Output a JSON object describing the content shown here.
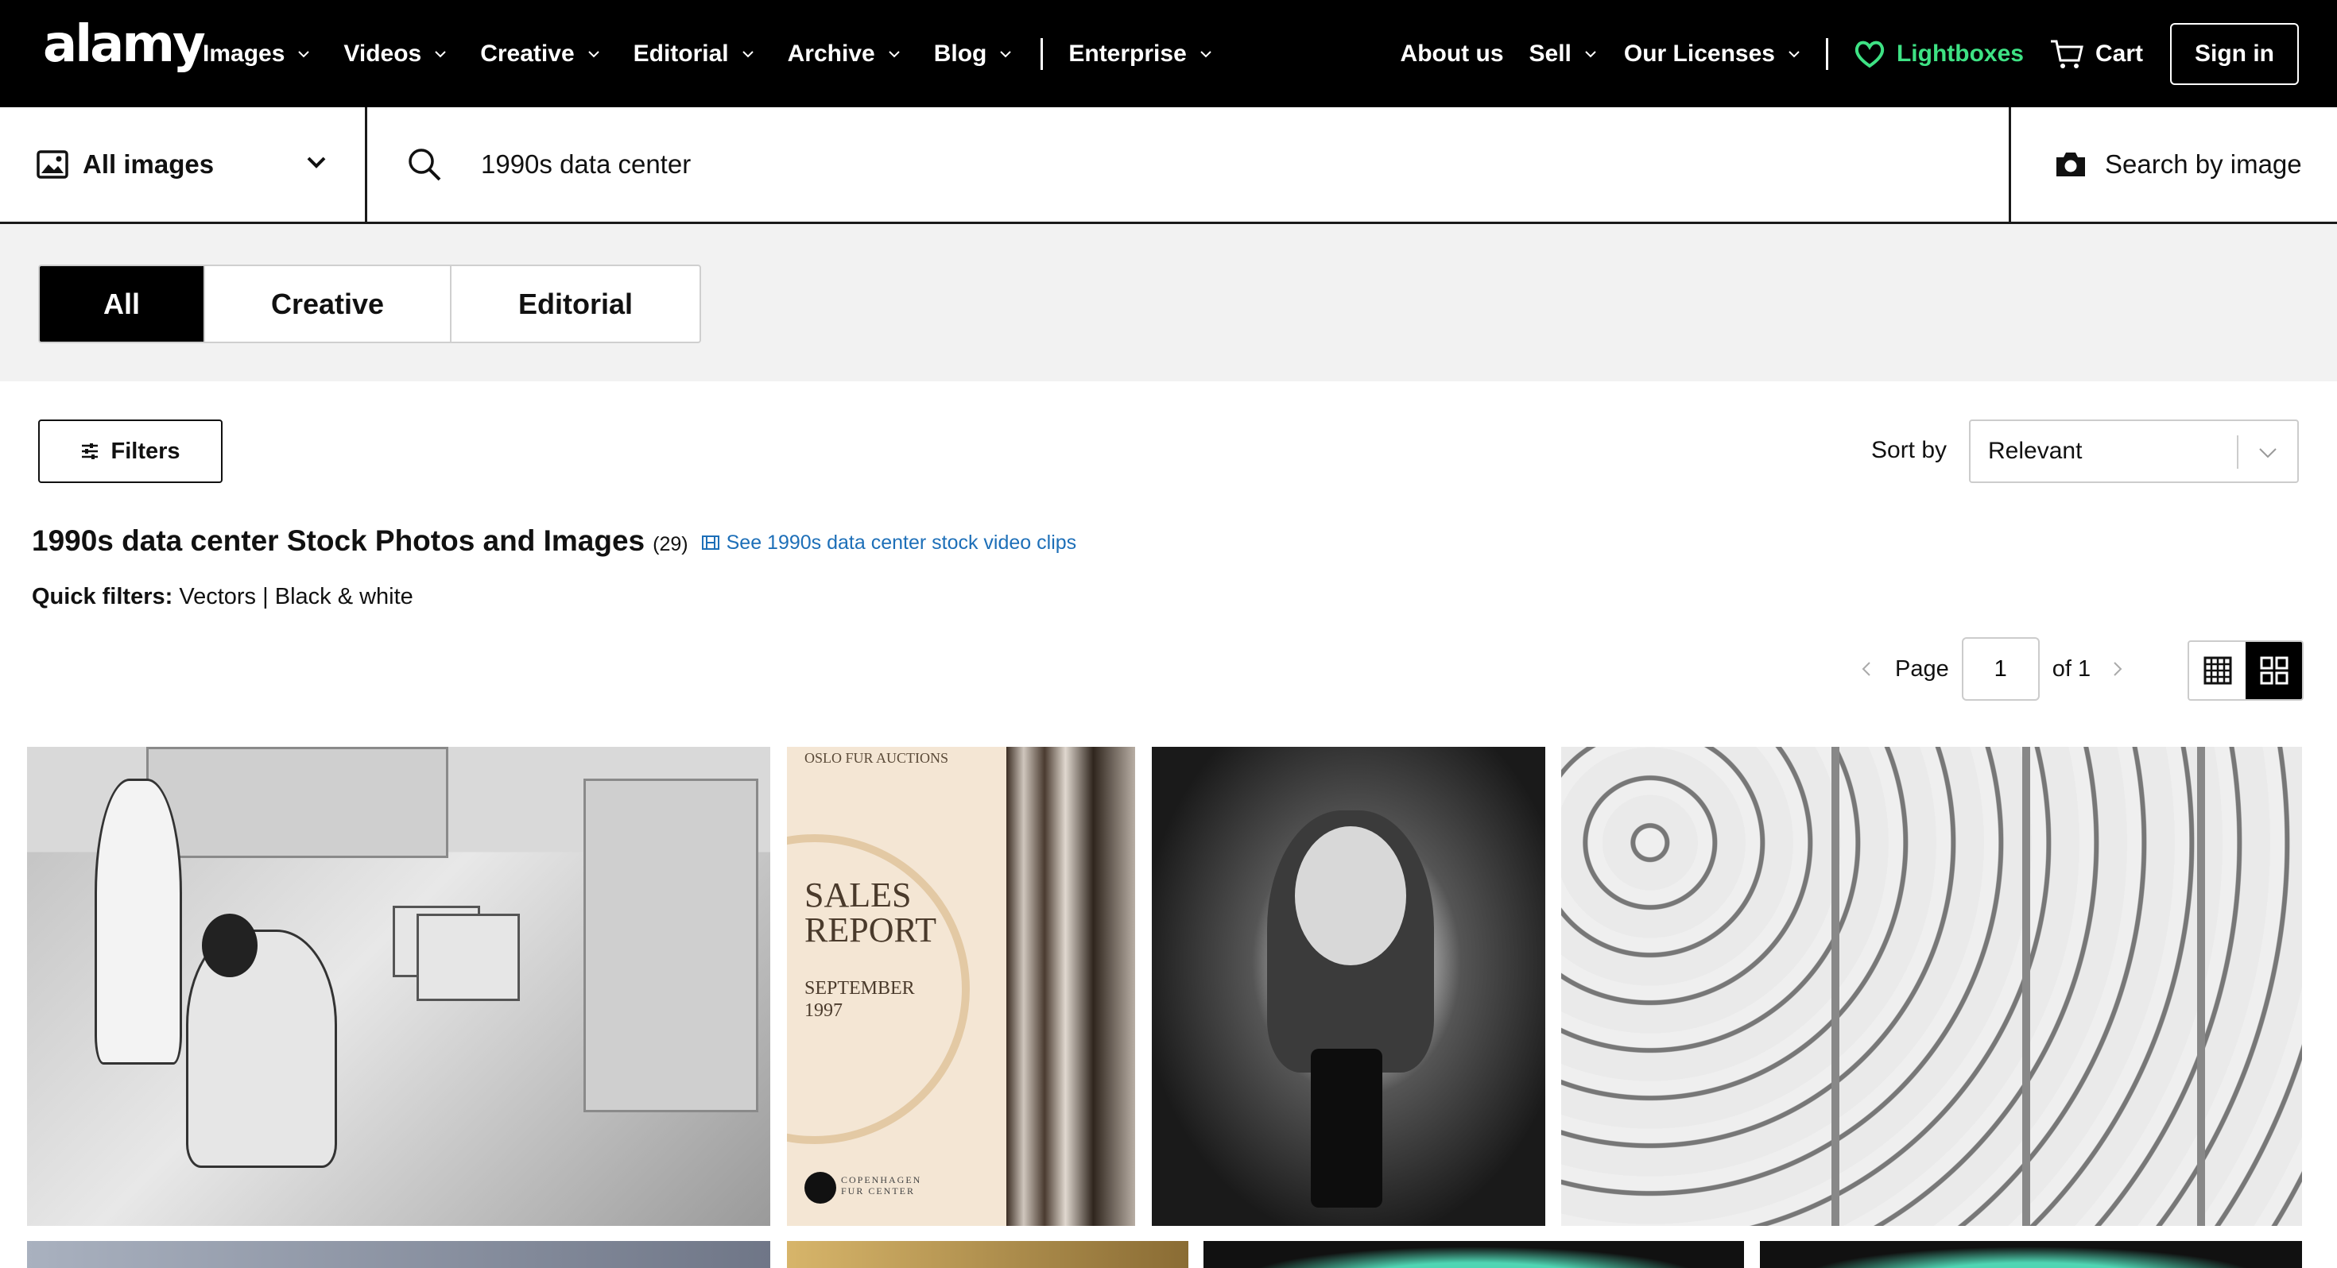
{
  "brand": {
    "logo_text": "alamy",
    "accent": "#3ee284",
    "link_color": "#1d6fb8"
  },
  "nav": {
    "left": [
      {
        "label": "Images",
        "dropdown": true
      },
      {
        "label": "Videos",
        "dropdown": true
      },
      {
        "label": "Creative",
        "dropdown": true
      },
      {
        "label": "Editorial",
        "dropdown": true
      },
      {
        "label": "Archive",
        "dropdown": true
      },
      {
        "label": "Blog",
        "dropdown": true
      },
      {
        "label": "Enterprise",
        "dropdown": true
      }
    ],
    "right": {
      "about": "About us",
      "sell": "Sell",
      "licenses": "Our Licenses",
      "lightboxes": "Lightboxes",
      "cart": "Cart",
      "signin": "Sign in"
    }
  },
  "search": {
    "scope": "All images",
    "query": "1990s data center",
    "by_image": "Search by image"
  },
  "tabs": [
    {
      "label": "All",
      "active": true
    },
    {
      "label": "Creative",
      "active": false
    },
    {
      "label": "Editorial",
      "active": false
    }
  ],
  "toolbar": {
    "filters": "Filters",
    "sort_label": "Sort by",
    "sort_value": "Relevant"
  },
  "results": {
    "title": "1990s data center Stock Photos and Images",
    "count": "(29)",
    "video_link": "See 1990s data center stock video clips",
    "quick_filters_label": "Quick filters:",
    "quick_filters": [
      "Vectors",
      "Black & white"
    ],
    "quick_sep": "|"
  },
  "pagination": {
    "page_label": "Page",
    "current": "1",
    "of_label": "of 1"
  },
  "thumbnails": {
    "t2_top": "OSLO FUR AUCTIONS",
    "t2_title_1": "SALES",
    "t2_title_2": "REPORT",
    "t2_date_1": "SEPTEMBER",
    "t2_date_2": "1997",
    "t2_foot": "COPENHAGEN FUR CENTER"
  }
}
